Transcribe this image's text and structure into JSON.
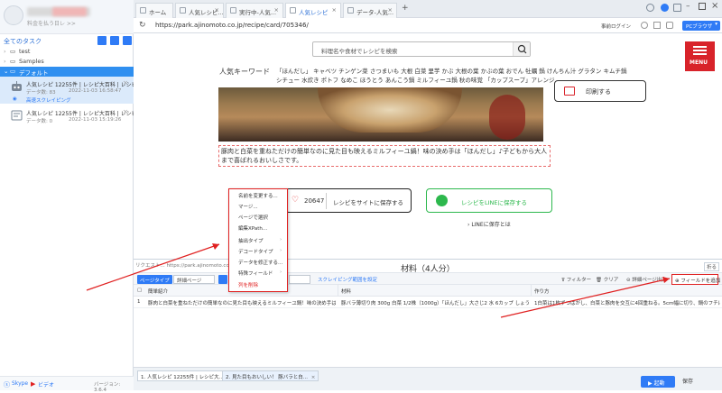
{
  "sidebar": {
    "username": "",
    "user_sub": "料金を払う日レ >>",
    "tasks_title": "全てのタスク",
    "tree": [
      {
        "label": "test",
        "selected": false
      },
      {
        "label": "Samples",
        "selected": false
      },
      {
        "label": "デフォルト",
        "selected": true
      }
    ],
    "tasks": [
      {
        "title": "人気レシピ 12255件 | レシピ大百科 | レシピ・...",
        "count": "データ数: 83",
        "date": "2022-11-03 16:58:47",
        "status": "高速スクレイピング",
        "selected": true
      },
      {
        "title": "人気レシピ 12255件 | レシピ大百科 | レシピ・...",
        "count": "データ数: 0",
        "date": "2022-11-03 15:19:26",
        "status": "",
        "selected": false
      }
    ],
    "footer": {
      "skype": "Skype",
      "video": "ビデオ",
      "version": "バージョン: 3.6.4"
    }
  },
  "browser": {
    "tabs": [
      {
        "label": "ホーム",
        "active": false
      },
      {
        "label": "人気レシピ...",
        "active": false
      },
      {
        "label": "実行中-人気...",
        "active": false
      },
      {
        "label": "人気レシピ",
        "active": true
      },
      {
        "label": "データ-人気...",
        "active": false
      }
    ],
    "new_tab": "+",
    "url": "https://park.ajinomoto.co.jp/recipe/card/705346/",
    "login": "事前ログイン",
    "pc_browser": "PCブラウザ"
  },
  "web": {
    "search_placeholder": "料理名や食材でレシピを検索",
    "menu_label": "MENU",
    "keywords_title": "人気キーワード",
    "keywords_line1": "「ほんだし」 キャベツ チンゲン菜 さつまいも 大根 白菜 里芋 かぶ 大根の葉 かぶの葉 おでん 牡蠣 鍋 けんちん汁 グラタン キムチ鍋",
    "keywords_line2": "シチュー 水炊き ポトフ なめこ ほうとう あんこう鍋 ミルフィーユ鍋 秋の味覚 「カップスープ」アレンジ",
    "print_label": "印刷する",
    "description": "豚肉と白菜を重ねただけの簡単なのに見た目も映えるミルフィーユ鍋！味の決め手は「ほんだし」♪子どもから大人まで喜ばれるおいしさです。",
    "likes": "20647",
    "save_site": "レシピをサイトに保存する",
    "save_line": "レシピをLINEに保存する",
    "line_save_q": "LINEに保存とは"
  },
  "context_menu": [
    {
      "label": "名前を変更する...",
      "arrow": false
    },
    {
      "label": "マージ...",
      "arrow": false
    },
    {
      "label": "ページで選択",
      "arrow": false
    },
    {
      "label": "編集XPath...",
      "arrow": false
    },
    {
      "label": "抽出タイプ",
      "arrow": true
    },
    {
      "label": "デコードタイプ",
      "arrow": true
    },
    {
      "label": "データを修正する...",
      "arrow": false
    },
    {
      "label": "特殊フィールド",
      "arrow": true
    },
    {
      "label": "列を削除",
      "arrow": false,
      "danger": true
    }
  ],
  "panel": {
    "hint": "リクエスト... https://park.ajinomoto.co.jp",
    "materials": "材料（4人分）",
    "close": "折る",
    "toolbar": {
      "page_type": "ページタイプ",
      "detail_page": "詳細ページ",
      "scraping_range": "スクレイピング範囲を設定",
      "filter": "フィルター",
      "clear": "クリア",
      "detail_list": "詳細ページ出力",
      "add_field": "フィールドを追加"
    },
    "columns": [
      "簡単紹介",
      "材料",
      "作り方"
    ],
    "rows": [
      {
        "num": "1",
        "intro": "豚肉と白菜を重ねただけの簡単なのに見た目も映えるミルフィーユ鍋！味の決め手は「ほんだし」...",
        "materials": "豚バラ薄切り肉 300g 白菜 1/2株（1000g）「ほんだし」大さじ2 水 6カップ しょうゆ 大...",
        "steps": "1白菜は1枚ずつはがし、白菜と豚肉を交互に4回重ねる。5cm幅に切り、鍋のフチに沿..."
      }
    ]
  },
  "bottom": {
    "tabs": [
      {
        "label": "1. 人気レシピ 12255件 | レシピ大...",
        "active": false
      },
      {
        "label": "2. 見た目もおいしい！ 豚バラと白...",
        "active": true
      }
    ],
    "start": "起動",
    "export": "保存"
  }
}
